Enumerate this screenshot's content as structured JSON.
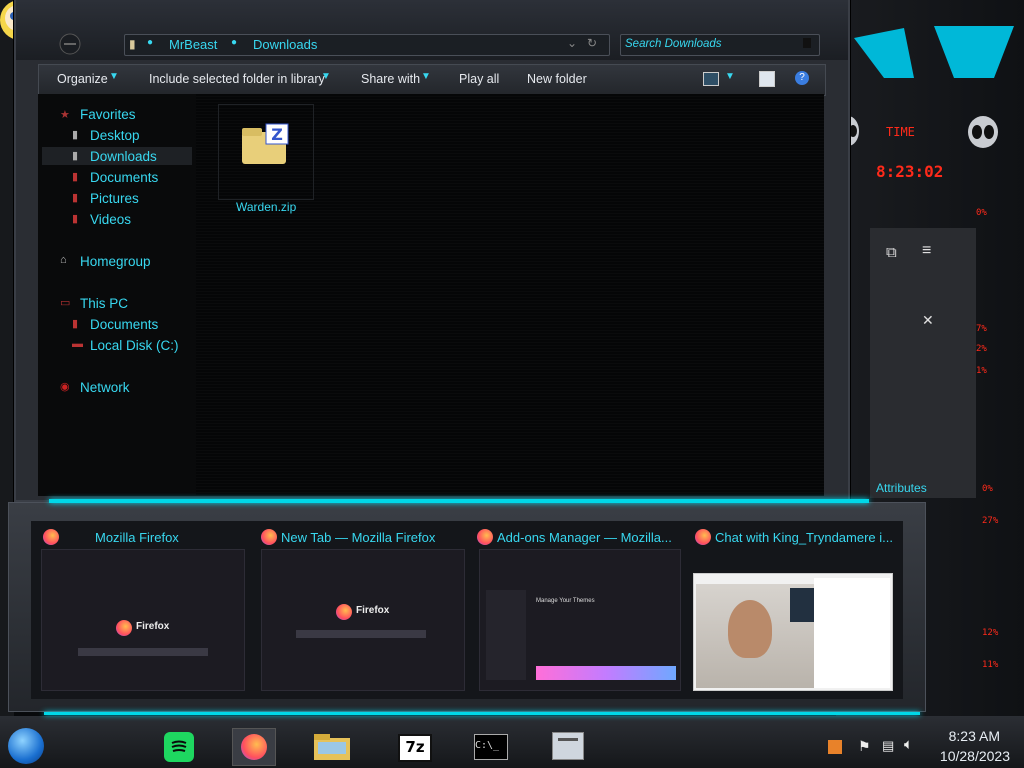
{
  "explorer": {
    "breadcrumb": [
      "MrBeast",
      "Downloads"
    ],
    "search_placeholder": "Search Downloads",
    "toolbar": {
      "organize": "Organize",
      "include_library": "Include selected folder in library",
      "share_with": "Share with",
      "play_all": "Play all",
      "new_folder": "New folder"
    },
    "nav": {
      "favorites": "Favorites",
      "desktop": "Desktop",
      "downloads": "Downloads",
      "documents": "Documents",
      "pictures": "Pictures",
      "videos": "Videos",
      "homegroup": "Homegroup",
      "this_pc": "This PC",
      "pc_documents": "Documents",
      "local_disk": "Local Disk (C:)",
      "network": "Network"
    },
    "files": [
      {
        "name": "Warden.zip",
        "icon": "zip-folder-icon"
      }
    ]
  },
  "widget": {
    "time_label": "TIME",
    "time_value": "8:23:02",
    "attributes": "Attributes",
    "percents": [
      "0%",
      "7%",
      "2%",
      "1%",
      "0%",
      "27%",
      "12%",
      "11%"
    ]
  },
  "thumbnails": [
    {
      "title": "Mozilla Firefox",
      "preview_text": "Firefox"
    },
    {
      "title": "New Tab — Mozilla Firefox",
      "preview_text": "Firefox"
    },
    {
      "title": "Add-ons Manager — Mozilla...",
      "preview_text": "Manage Your Themes"
    },
    {
      "title": "Chat with King_Tryndamere i...",
      "preview_text": ""
    }
  ],
  "taskbar": {
    "time": "8:23 AM",
    "date": "10/28/2023"
  },
  "colors": {
    "accent": "#38d8f0",
    "red": "#ff2a1a",
    "window_bg": "#2a2d33"
  }
}
